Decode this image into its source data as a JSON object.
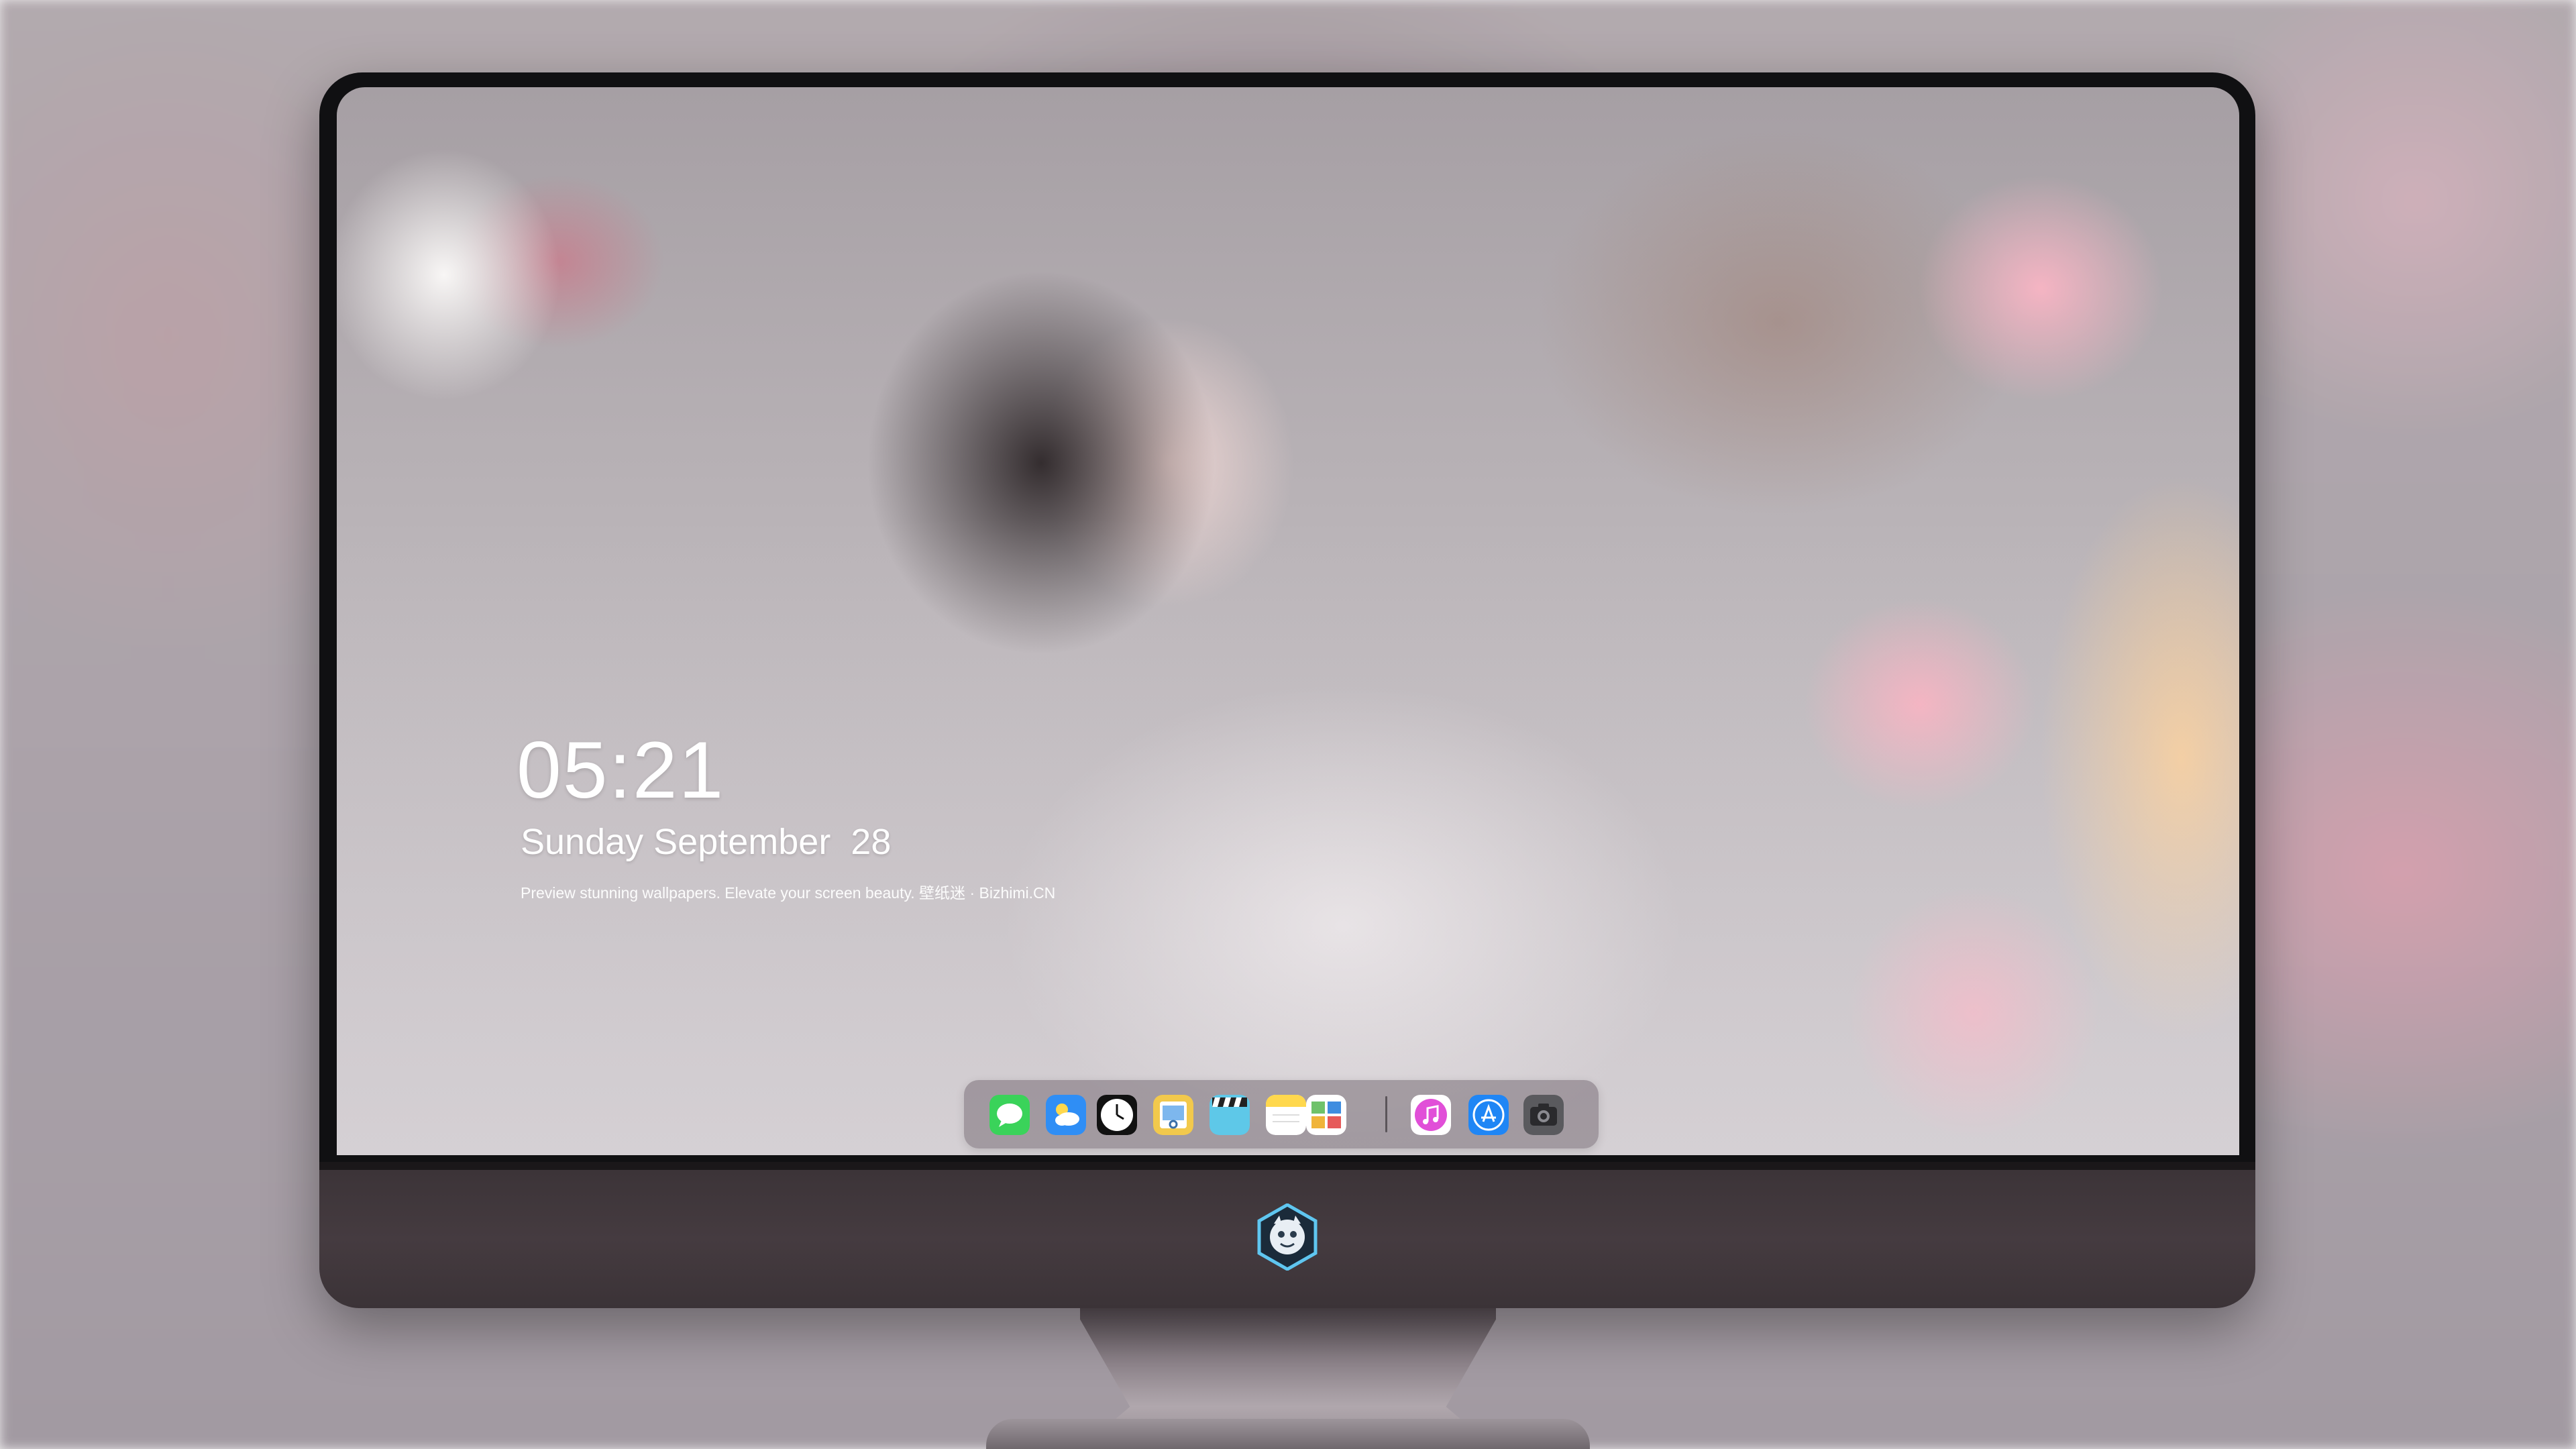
{
  "lockscreen": {
    "time": "05:21",
    "date": "Sunday September  28",
    "tagline": "Preview stunning wallpapers. Elevate your screen beauty. 壁纸迷 · Bizhimi.CN"
  },
  "dock": {
    "items": [
      {
        "name": "messages",
        "icon": "speech-bubble-icon",
        "color": "#3ad35a"
      },
      {
        "name": "weather",
        "icon": "cloud-sun-icon",
        "color": "#2f8ef5"
      },
      {
        "name": "clock",
        "icon": "clock-icon",
        "color": "#111111"
      },
      {
        "name": "preview",
        "icon": "photo-viewer-icon",
        "color": "#f2c94c"
      },
      {
        "name": "video",
        "icon": "clapperboard-icon",
        "color": "#5ec8e8"
      },
      {
        "name": "notes",
        "icon": "notepad-icon",
        "color": "#ffd84d"
      },
      {
        "name": "photos",
        "icon": "photo-collage-icon",
        "color": "#ffffff"
      },
      {
        "name": "music",
        "icon": "music-note-icon",
        "color": "#e14fd8"
      },
      {
        "name": "app-store",
        "icon": "app-store-icon",
        "color": "#1f86f5"
      },
      {
        "name": "camera",
        "icon": "camera-icon",
        "color": "#5a5a5e"
      }
    ]
  },
  "colors": {
    "bezel": "#101012",
    "chin": "#3f363b",
    "dock_bg": "#786e76"
  }
}
